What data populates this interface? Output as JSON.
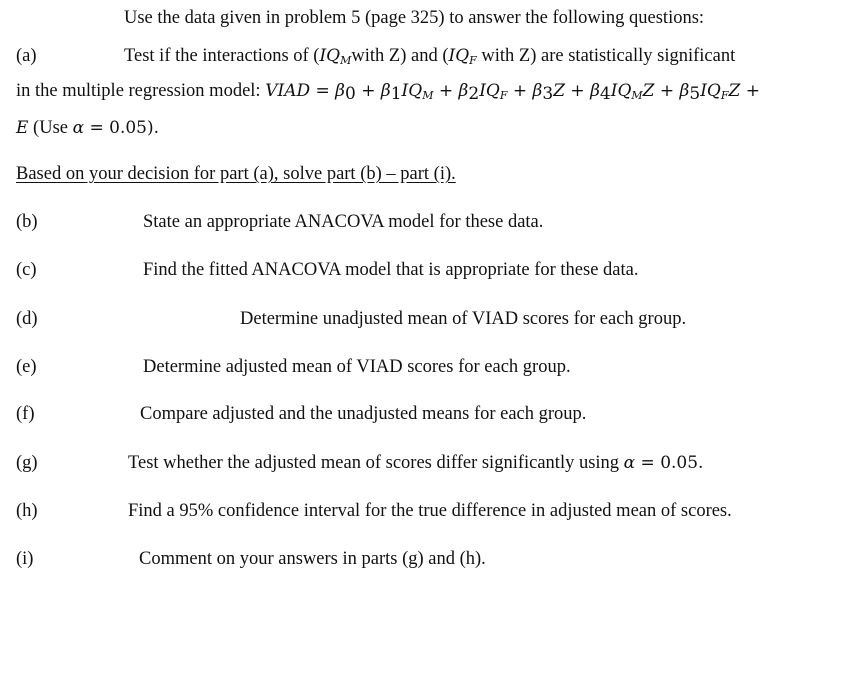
{
  "intro": "Use the data given in problem 5 (page 325) to answer the following questions:",
  "part_a": {
    "label": "(a)",
    "line1_prefix": "Test if the interactions of (",
    "iq": "IQ",
    "sub_m": "M",
    "sub_f": "F",
    "with_z_1": "with Z) and (",
    "with_z_2": " with Z) are statistically significant",
    "line2_prefix": "in the multiple regression model: ",
    "model_lhs": "VIAD",
    "eq": " = ",
    "b0": "β",
    "b0s": "0",
    "b1": "β",
    "b1s": "1",
    "b2": "β",
    "b2s": "2",
    "b3": "β",
    "b3s": "3",
    "b4": "β",
    "b4s": "4",
    "b5": "β",
    "b5s": "5",
    "z": "Z",
    "plus": " + ",
    "e": "E",
    "alpha_text": " (Use ",
    "alpha": "α",
    "alpha_val": " = 0.05)."
  },
  "instruction": "Based on your decision for part (a), solve part (b) – part (i).",
  "parts": [
    {
      "label": "(b)",
      "text": "State an appropriate ANACOVA model for these data."
    },
    {
      "label": "(c)",
      "text": "Find the fitted ANACOVA model that is appropriate for these data."
    },
    {
      "label": "(d)",
      "text": "Determine unadjusted mean of VIAD scores for each group."
    },
    {
      "label": "(e)",
      "text": "Determine adjusted mean of VIAD scores for each group."
    },
    {
      "label": "(f)",
      "text": "Compare adjusted and the unadjusted means for each group."
    },
    {
      "label": "(g)",
      "text": "Test whether the adjusted mean of scores differ significantly using ",
      "alpha": "α",
      "alpha_val": " = 0.05."
    },
    {
      "label": "(h)",
      "text": "Find a 95% confidence interval for the true difference in adjusted mean of scores."
    },
    {
      "label": "(i)",
      "text": "Comment on your answers in parts (g) and (h)."
    }
  ]
}
